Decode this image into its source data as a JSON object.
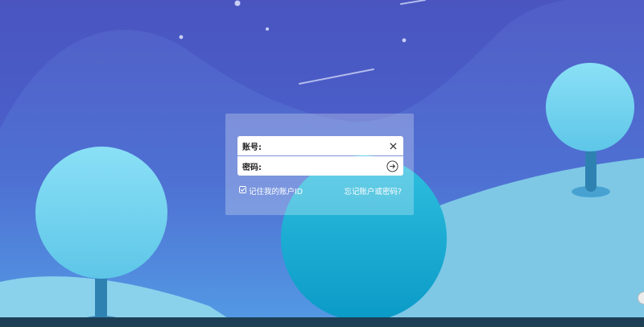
{
  "colors": {
    "sky_top": "#4a55c0",
    "sky_bottom": "#5fa9ea",
    "hill": "#7ec8e6",
    "moon": "#e6d30a",
    "tree_canopy": "#7dd8f0",
    "tree_trunk": "#2e82b2",
    "bottom_bar": "#1c3f56"
  },
  "login": {
    "account_label": "账号:",
    "account_value": "",
    "password_label": "密码:",
    "password_value": "",
    "remember_label": "记住我的账户ID",
    "remember_checked": true,
    "forgot_link": "忘记账户或密码?"
  },
  "icons": {
    "clear": "close-icon",
    "submit": "arrow-right-circle-icon",
    "remember": "checkbox-checked-icon",
    "moon": "crescent-moon-icon"
  }
}
